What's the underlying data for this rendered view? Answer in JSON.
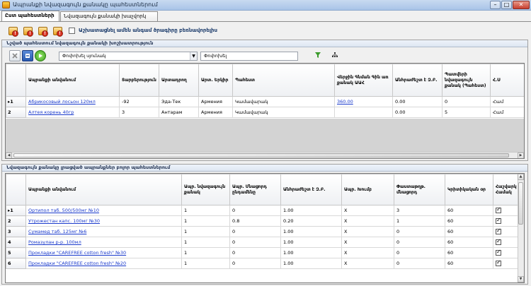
{
  "window": {
    "title": "Ապրանքի նվազագույն քանակը պահեստներում"
  },
  "tabs": [
    {
      "label": "Ըստ պահեստների"
    },
    {
      "label": "Նվազագույն քանակի խաչվորկ"
    }
  ],
  "toolbar": {
    "checkbox_label": "Աշխատացնել ամեն անգամ ծրագիրը բեռնավորելիս"
  },
  "upper_panel": {
    "title": "Նշված պահեստում նվազագույն քանակի խոշխատրություն",
    "column_chooser": "Փոփոխել սյունակ",
    "filter_label": "Փոփոխել"
  },
  "upper_table": {
    "columns": [
      "Ապրանքի անվանում",
      "Տարբերություն",
      "Արտադրող",
      "Արտ. Երկիր",
      "Պահեստ",
      "Վերջին Գնման Գին առ քանակ ԱԱՀ",
      "Անհրաժեշտ է Զ.Բ.",
      "Պատվերի նվազագույն քանակ (Պահեստ)",
      "Հ.Ս"
    ],
    "rows": [
      {
        "num": "1",
        "name": "Абрикосовый лосьон 120мл",
        "diff": "-92",
        "maker": "Эда-Тек",
        "country": "Армения",
        "store": "Կամավարակ",
        "price": "360.00",
        "need": "0.00",
        "minq": "0",
        "last": "Համ"
      },
      {
        "num": "2",
        "name": "Алтея корень 40гр",
        "diff": "3",
        "maker": "Антарам",
        "country": "Армения",
        "store": "Կամավարակ",
        "price": "",
        "need": "0.00",
        "minq": "5",
        "last": "Համ"
      }
    ]
  },
  "lower_panel": {
    "title": "Նվազագույն քանակը լրացված ապրանքներ բոլոր պահեստներում"
  },
  "lower_table": {
    "columns": [
      "Ապրանքի անվանում",
      "Ապր. նվազագույն քանակ",
      "Ապր. Մնացորդ ընդամենը",
      "Անհրաժեշտ է Զ.Բ.",
      "Ապր. Խումբ",
      "Փաստաթղթ. մնացորդ",
      "Կրիտիկական օր",
      "Հաշվարկ է Համակ"
    ],
    "rows": [
      {
        "num": "1",
        "name": "Ортипол таб. 500/500мг №10",
        "minq": "1",
        "rest": "0",
        "need": "1.00",
        "group": "X",
        "doc": "3",
        "days": "60",
        "chk": true
      },
      {
        "num": "2",
        "name": "Утрожестан капс. 100мг №30",
        "minq": "1",
        "rest": "0.8",
        "need": "0.20",
        "group": "X",
        "doc": "1",
        "days": "60",
        "chk": true
      },
      {
        "num": "3",
        "name": "Сумамед таб. 125мг №6",
        "minq": "1",
        "rest": "0",
        "need": "1.00",
        "group": "X",
        "doc": "0",
        "days": "60",
        "chk": true
      },
      {
        "num": "4",
        "name": "Ромазулан р-р. 100мл",
        "minq": "1",
        "rest": "0",
        "need": "1.00",
        "group": "X",
        "doc": "0",
        "days": "60",
        "chk": true
      },
      {
        "num": "5",
        "name": "Прокладки \"CAREFREE cotton fresh\" №30",
        "minq": "1",
        "rest": "0",
        "need": "1.00",
        "group": "X",
        "doc": "0",
        "days": "60",
        "chk": true
      },
      {
        "num": "6",
        "name": "Прокладки \"CAREFREE cotton fresh\" №20",
        "minq": "1",
        "rest": "0",
        "need": "1.00",
        "group": "X",
        "doc": "0",
        "days": "60",
        "chk": true
      }
    ]
  },
  "colors": {
    "link": "#1a3acc",
    "titlebar": "#b6cdea",
    "empty_grid": "#d3d3d3"
  }
}
